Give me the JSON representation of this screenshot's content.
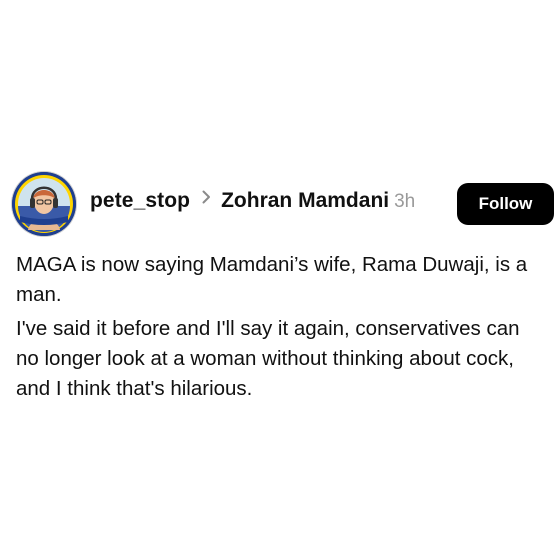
{
  "post": {
    "author": {
      "username": "pete_stop",
      "avatar_badge": "#StandWithUkraine",
      "avatar_icon": "profile-photo"
    },
    "separator_icon": "chevron-right-icon",
    "community": "Zohran Mamdani",
    "timestamp": "3h",
    "follow_label": "Follow",
    "paragraphs": [
      "MAGA is now saying Mamdani’s wife, Rama Duwaji, is a man.",
      "I've said it before and I'll say it again, conservatives can no longer look at a woman without thinking about cock, and I think that's hilarious."
    ]
  },
  "colors": {
    "background": "#ffffff",
    "text": "#111111",
    "timestamp": "#9a9a9a",
    "button_bg": "#000000",
    "button_text": "#ffffff",
    "avatar_ring_yellow": "#ffd500",
    "avatar_ring_blue": "#1f3f8f"
  }
}
